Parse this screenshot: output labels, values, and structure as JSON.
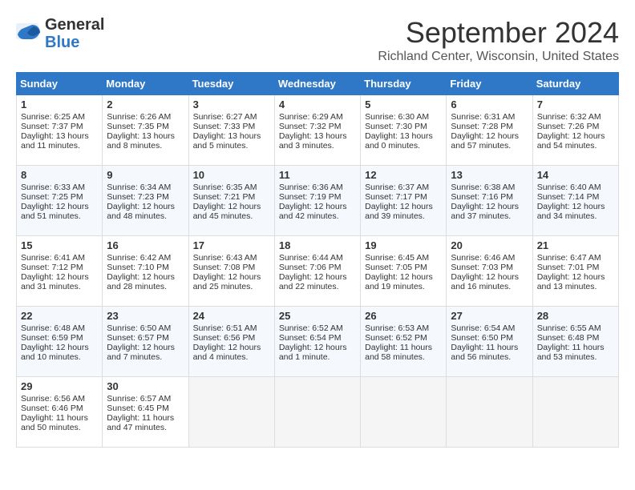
{
  "header": {
    "logo_line1": "General",
    "logo_line2": "Blue",
    "month": "September 2024",
    "location": "Richland Center, Wisconsin, United States"
  },
  "weekdays": [
    "Sunday",
    "Monday",
    "Tuesday",
    "Wednesday",
    "Thursday",
    "Friday",
    "Saturday"
  ],
  "weeks": [
    [
      {
        "day": 1,
        "sunrise": "6:25 AM",
        "sunset": "7:37 PM",
        "daylight": "13 hours and 11 minutes."
      },
      {
        "day": 2,
        "sunrise": "6:26 AM",
        "sunset": "7:35 PM",
        "daylight": "13 hours and 8 minutes."
      },
      {
        "day": 3,
        "sunrise": "6:27 AM",
        "sunset": "7:33 PM",
        "daylight": "13 hours and 5 minutes."
      },
      {
        "day": 4,
        "sunrise": "6:29 AM",
        "sunset": "7:32 PM",
        "daylight": "13 hours and 3 minutes."
      },
      {
        "day": 5,
        "sunrise": "6:30 AM",
        "sunset": "7:30 PM",
        "daylight": "13 hours and 0 minutes."
      },
      {
        "day": 6,
        "sunrise": "6:31 AM",
        "sunset": "7:28 PM",
        "daylight": "12 hours and 57 minutes."
      },
      {
        "day": 7,
        "sunrise": "6:32 AM",
        "sunset": "7:26 PM",
        "daylight": "12 hours and 54 minutes."
      }
    ],
    [
      {
        "day": 8,
        "sunrise": "6:33 AM",
        "sunset": "7:25 PM",
        "daylight": "12 hours and 51 minutes."
      },
      {
        "day": 9,
        "sunrise": "6:34 AM",
        "sunset": "7:23 PM",
        "daylight": "12 hours and 48 minutes."
      },
      {
        "day": 10,
        "sunrise": "6:35 AM",
        "sunset": "7:21 PM",
        "daylight": "12 hours and 45 minutes."
      },
      {
        "day": 11,
        "sunrise": "6:36 AM",
        "sunset": "7:19 PM",
        "daylight": "12 hours and 42 minutes."
      },
      {
        "day": 12,
        "sunrise": "6:37 AM",
        "sunset": "7:17 PM",
        "daylight": "12 hours and 39 minutes."
      },
      {
        "day": 13,
        "sunrise": "6:38 AM",
        "sunset": "7:16 PM",
        "daylight": "12 hours and 37 minutes."
      },
      {
        "day": 14,
        "sunrise": "6:40 AM",
        "sunset": "7:14 PM",
        "daylight": "12 hours and 34 minutes."
      }
    ],
    [
      {
        "day": 15,
        "sunrise": "6:41 AM",
        "sunset": "7:12 PM",
        "daylight": "12 hours and 31 minutes."
      },
      {
        "day": 16,
        "sunrise": "6:42 AM",
        "sunset": "7:10 PM",
        "daylight": "12 hours and 28 minutes."
      },
      {
        "day": 17,
        "sunrise": "6:43 AM",
        "sunset": "7:08 PM",
        "daylight": "12 hours and 25 minutes."
      },
      {
        "day": 18,
        "sunrise": "6:44 AM",
        "sunset": "7:06 PM",
        "daylight": "12 hours and 22 minutes."
      },
      {
        "day": 19,
        "sunrise": "6:45 AM",
        "sunset": "7:05 PM",
        "daylight": "12 hours and 19 minutes."
      },
      {
        "day": 20,
        "sunrise": "6:46 AM",
        "sunset": "7:03 PM",
        "daylight": "12 hours and 16 minutes."
      },
      {
        "day": 21,
        "sunrise": "6:47 AM",
        "sunset": "7:01 PM",
        "daylight": "12 hours and 13 minutes."
      }
    ],
    [
      {
        "day": 22,
        "sunrise": "6:48 AM",
        "sunset": "6:59 PM",
        "daylight": "12 hours and 10 minutes."
      },
      {
        "day": 23,
        "sunrise": "6:50 AM",
        "sunset": "6:57 PM",
        "daylight": "12 hours and 7 minutes."
      },
      {
        "day": 24,
        "sunrise": "6:51 AM",
        "sunset": "6:56 PM",
        "daylight": "12 hours and 4 minutes."
      },
      {
        "day": 25,
        "sunrise": "6:52 AM",
        "sunset": "6:54 PM",
        "daylight": "12 hours and 1 minute."
      },
      {
        "day": 26,
        "sunrise": "6:53 AM",
        "sunset": "6:52 PM",
        "daylight": "11 hours and 58 minutes."
      },
      {
        "day": 27,
        "sunrise": "6:54 AM",
        "sunset": "6:50 PM",
        "daylight": "11 hours and 56 minutes."
      },
      {
        "day": 28,
        "sunrise": "6:55 AM",
        "sunset": "6:48 PM",
        "daylight": "11 hours and 53 minutes."
      }
    ],
    [
      {
        "day": 29,
        "sunrise": "6:56 AM",
        "sunset": "6:46 PM",
        "daylight": "11 hours and 50 minutes."
      },
      {
        "day": 30,
        "sunrise": "6:57 AM",
        "sunset": "6:45 PM",
        "daylight": "11 hours and 47 minutes."
      },
      null,
      null,
      null,
      null,
      null
    ]
  ]
}
